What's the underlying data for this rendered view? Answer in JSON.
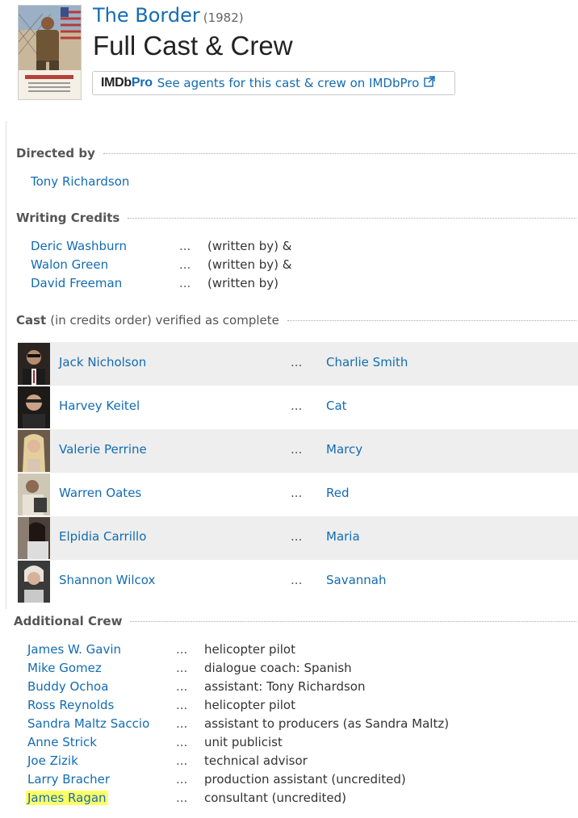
{
  "header": {
    "movie_title": "The Border",
    "year": "(1982)",
    "page_title": "Full Cast & Crew",
    "pro_logo_imdb": "IMDb",
    "pro_logo_pro": "Pro",
    "pro_link": "See agents for this cast & crew on IMDbPro",
    "pro_icon": "external-link-icon"
  },
  "directed_by": {
    "heading": "Directed by",
    "people": [
      {
        "name": "Tony Richardson"
      }
    ]
  },
  "writing": {
    "heading": "Writing Credits",
    "credits": [
      {
        "name": "Deric Washburn",
        "role": "(written by) &"
      },
      {
        "name": "Walon Green",
        "role": "(written by) &"
      },
      {
        "name": "David Freeman",
        "role": "(written by)"
      }
    ]
  },
  "cast": {
    "heading": "Cast",
    "subheading": "(in credits order) verified as complete",
    "ellipsis": "...",
    "members": [
      {
        "name": "Jack Nicholson",
        "character": "Charlie Smith"
      },
      {
        "name": "Harvey Keitel",
        "character": "Cat"
      },
      {
        "name": "Valerie Perrine",
        "character": "Marcy"
      },
      {
        "name": "Warren Oates",
        "character": "Red"
      },
      {
        "name": "Elpidia Carrillo",
        "character": "Maria"
      },
      {
        "name": "Shannon Wilcox",
        "character": "Savannah"
      }
    ]
  },
  "crew": {
    "heading": "Additional Crew",
    "ellipsis": "...",
    "members": [
      {
        "name": "James W. Gavin",
        "role": "helicopter pilot"
      },
      {
        "name": "Mike Gomez",
        "role": "dialogue coach: Spanish"
      },
      {
        "name": "Buddy Ochoa",
        "role": "assistant: Tony Richardson"
      },
      {
        "name": "Ross Reynolds",
        "role": "helicopter pilot"
      },
      {
        "name": "Sandra Maltz Saccio",
        "role": "assistant to producers (as Sandra Maltz)"
      },
      {
        "name": "Anne Strick",
        "role": "unit publicist"
      },
      {
        "name": "Joe Zizik",
        "role": "technical advisor"
      },
      {
        "name": "Larry Bracher",
        "role": "production assistant (uncredited)"
      },
      {
        "name": "James Ragan",
        "role": "consultant (uncredited)",
        "highlighted": true
      }
    ]
  },
  "colors": {
    "link": "#136cb2",
    "highlight": "#ffff66",
    "row_shade": "#eeeeee"
  }
}
